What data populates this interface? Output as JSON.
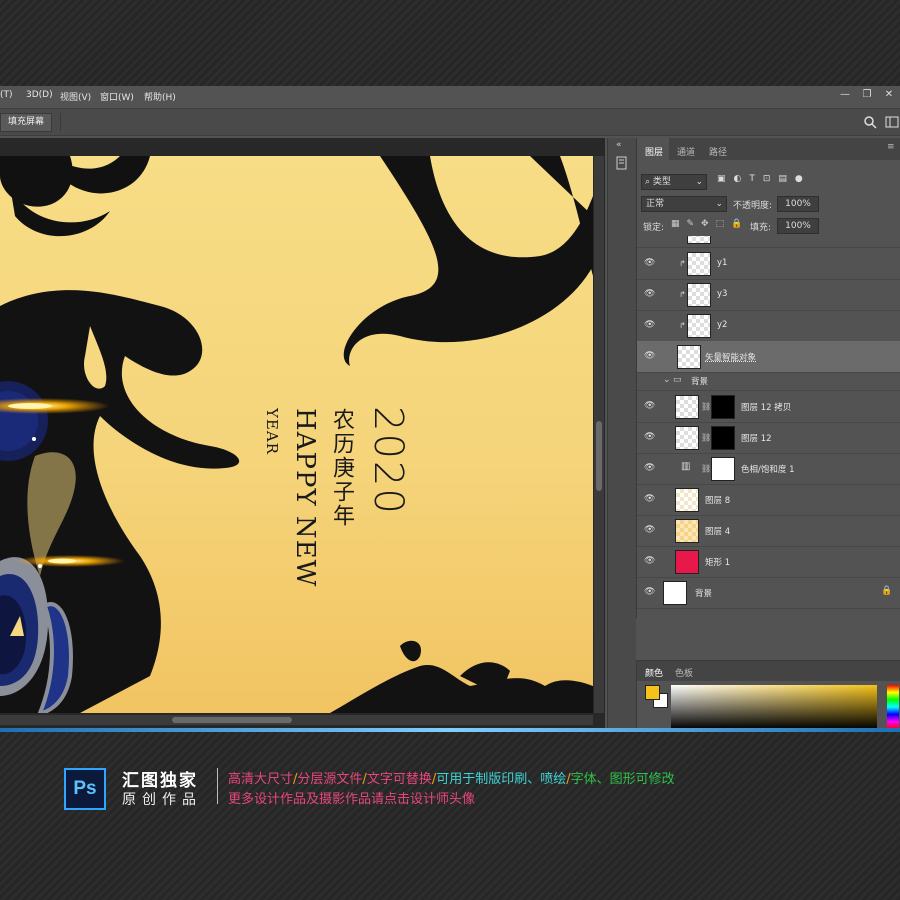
{
  "menu": {
    "items": [
      "3D(D)",
      "视图(V)",
      "窗口(W)",
      "帮助(H)"
    ],
    "partial_left": "(T)"
  },
  "options_bar": {
    "fill_screen_label": "填充屏幕"
  },
  "poster": {
    "number": "2020",
    "cn_title": "农历庚子年",
    "happy_new": "HAPPY NEW",
    "year": "YEAR"
  },
  "layers_panel": {
    "tabs": [
      "图层",
      "通道",
      "路径"
    ],
    "filter_kind": "类型",
    "blend_mode": "正常",
    "opacity_label": "不透明度:",
    "opacity_value": "100%",
    "lock_label": "锁定:",
    "fill_label": "填充:",
    "fill_value": "100%",
    "layers": [
      {
        "name": "y1",
        "thumb": "checker"
      },
      {
        "name": "y3",
        "thumb": "checker"
      },
      {
        "name": "y2",
        "thumb": "checker"
      },
      {
        "name": "矢量智能对象",
        "thumb": "checker",
        "selected": true
      },
      {
        "name": "背景",
        "type": "group"
      },
      {
        "name": "图层 12 拷贝",
        "thumb": "checker",
        "mask": true
      },
      {
        "name": "图层 12",
        "thumb": "checker",
        "mask": true
      },
      {
        "name": "色相/饱和度 1",
        "thumb": "adjust",
        "mask": "white"
      },
      {
        "name": "图层 8",
        "thumb": "checker-warm"
      },
      {
        "name": "图层 4",
        "thumb": "checker-warm"
      },
      {
        "name": "矩形 1",
        "thumb": "red"
      },
      {
        "name": "背景",
        "thumb": "white",
        "locked": true
      }
    ]
  },
  "color_panel": {
    "tabs": [
      "颜色",
      "色板"
    ],
    "foreground": "#f4c21a",
    "background": "#ffffff"
  },
  "banner": {
    "logo": "Ps",
    "title": "汇图独家",
    "subtitle": "原创作品",
    "features": [
      {
        "text": "高清大尺寸",
        "color": "#e8477a"
      },
      {
        "text": "/",
        "color": "#f0a020"
      },
      {
        "text": "分层源文件",
        "color": "#e8477a"
      },
      {
        "text": "/",
        "color": "#f0a020"
      },
      {
        "text": "文字可替换",
        "color": "#e8477a"
      },
      {
        "text": "/",
        "color": "#f0a020"
      },
      {
        "text": "可用于制版印刷、喷绘",
        "color": "#3fd4d4"
      },
      {
        "text": "/",
        "color": "#f0a020"
      },
      {
        "text": "字体、图形可修改",
        "color": "#2fc24a"
      }
    ],
    "more": "更多设计作品及摄影作品请点击设计师头像"
  }
}
